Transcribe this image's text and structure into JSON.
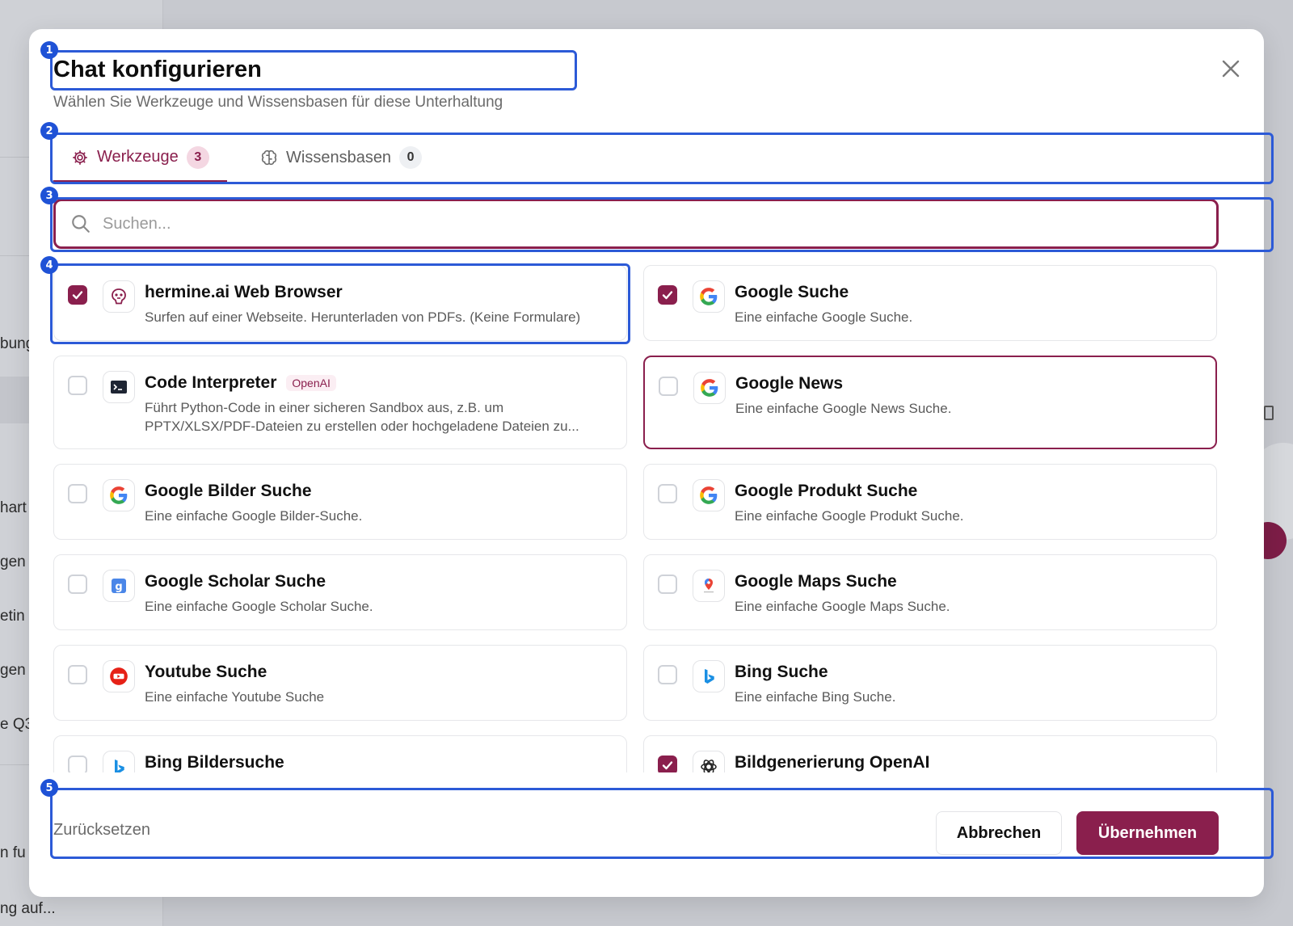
{
  "background": {
    "sidebar_fragments": [
      "bung",
      "hart",
      "gen",
      "etin",
      "gen",
      "e Q3",
      "n fu",
      "ng auf..."
    ]
  },
  "modal": {
    "title": "Chat konfigurieren",
    "subtitle": "Wählen Sie Werkzeuge und Wissensbasen für diese Unterhaltung",
    "close_icon": "close-icon"
  },
  "markers": [
    "1",
    "2",
    "3",
    "4",
    "5"
  ],
  "tabs": [
    {
      "label": "Werkzeuge",
      "count": "3",
      "icon": "gear-icon",
      "active": true
    },
    {
      "label": "Wissensbasen",
      "count": "0",
      "icon": "brain-icon",
      "active": false
    }
  ],
  "search": {
    "placeholder": "Suchen...",
    "value": ""
  },
  "tools": [
    {
      "title": "hermine.ai Web Browser",
      "description": "Surfen auf einer Webseite. Herunterladen von PDFs. (Keine Formulare)",
      "icon": "hermine-icon",
      "checked": true,
      "tag": ""
    },
    {
      "title": "Google Suche",
      "description": "Eine einfache Google Suche.",
      "icon": "google-icon",
      "checked": true,
      "tag": ""
    },
    {
      "title": "Code Interpreter",
      "description": "Führt Python-Code in einer sicheren Sandbox aus, z.B. um PPTX/XLSX/PDF-Dateien zu erstellen oder hochgeladene Dateien zu...",
      "icon": "terminal-icon",
      "checked": false,
      "tag": "OpenAI"
    },
    {
      "title": "Google News",
      "description": "Eine einfache Google News Suche.",
      "icon": "google-icon",
      "checked": false,
      "tag": ""
    },
    {
      "title": "Google Bilder Suche",
      "description": "Eine einfache Google Bilder-Suche.",
      "icon": "google-icon",
      "checked": false,
      "tag": ""
    },
    {
      "title": "Google Produkt Suche",
      "description": "Eine einfache Google Produkt Suche.",
      "icon": "google-icon",
      "checked": false,
      "tag": ""
    },
    {
      "title": "Google Scholar Suche",
      "description": "Eine einfache Google Scholar Suche.",
      "icon": "google-scholar-icon",
      "checked": false,
      "tag": ""
    },
    {
      "title": "Google Maps Suche",
      "description": "Eine einfache Google Maps Suche.",
      "icon": "google-maps-icon",
      "checked": false,
      "tag": ""
    },
    {
      "title": "Youtube Suche",
      "description": "Eine einfache Youtube Suche",
      "icon": "youtube-icon",
      "checked": false,
      "tag": ""
    },
    {
      "title": "Bing Suche",
      "description": "Eine einfache Bing Suche.",
      "icon": "bing-icon",
      "checked": false,
      "tag": ""
    },
    {
      "title": "Bing Bildersuche",
      "description": "",
      "icon": "bing-icon",
      "checked": false,
      "tag": ""
    },
    {
      "title": "Bildgenerierung OpenAI",
      "description": "",
      "icon": "openai-icon",
      "checked": true,
      "tag": ""
    }
  ],
  "footer": {
    "reset_label": "Zurücksetzen",
    "cancel_label": "Abbrechen",
    "apply_label": "Übernehmen"
  },
  "colors": {
    "accent": "#8a1f4d",
    "marker": "#1f52d6"
  }
}
